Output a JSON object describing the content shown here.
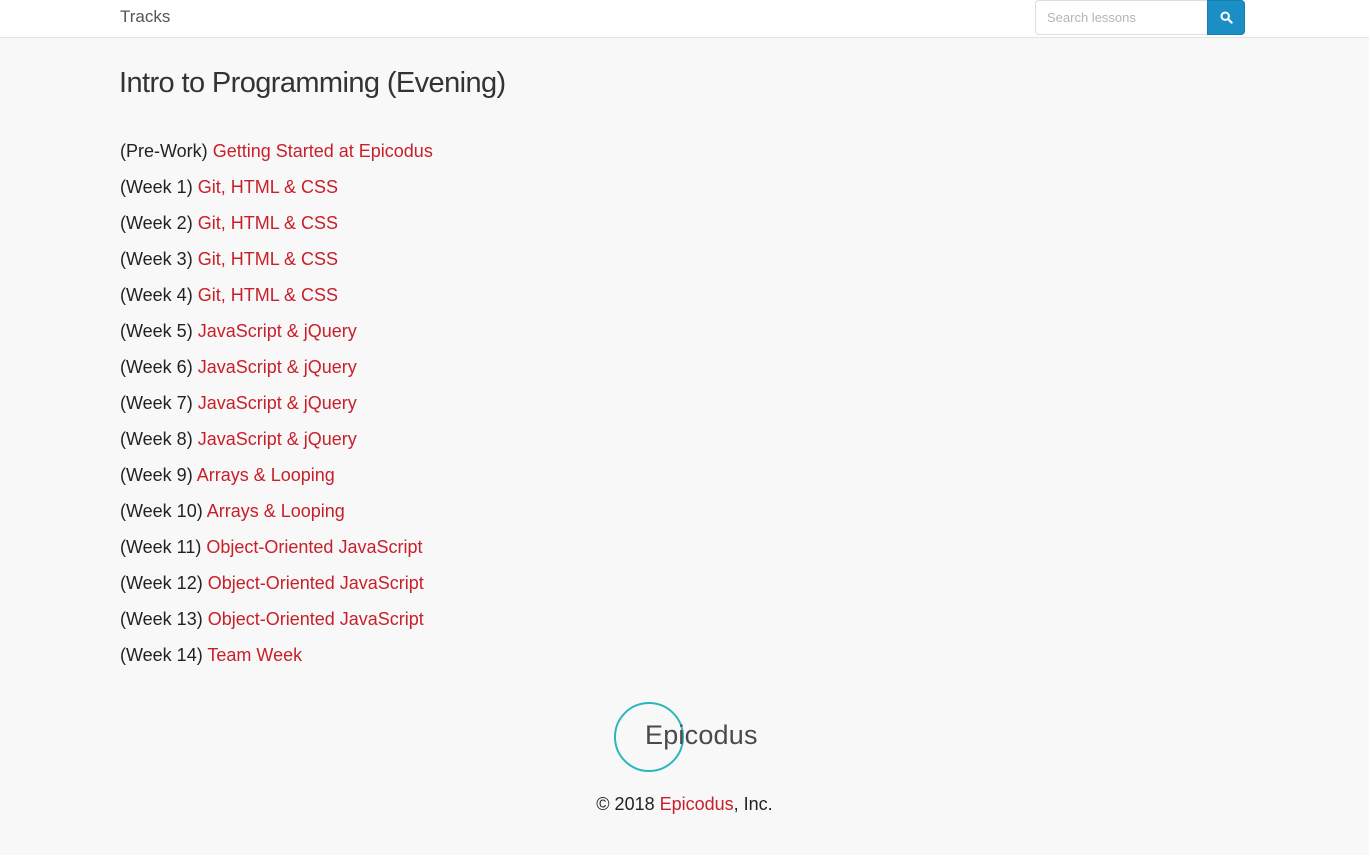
{
  "nav": {
    "brand": "Tracks",
    "search": {
      "placeholder": "Search lessons",
      "value": ""
    },
    "search_button_icon": "search-icon"
  },
  "page": {
    "title": "Intro to Programming (Evening)"
  },
  "lessons": [
    {
      "prefix": "(Pre-Work)",
      "title": "Getting Started at Epicodus"
    },
    {
      "prefix": "(Week 1)",
      "title": "Git, HTML & CSS"
    },
    {
      "prefix": "(Week 2)",
      "title": "Git, HTML & CSS"
    },
    {
      "prefix": "(Week 3)",
      "title": "Git, HTML & CSS"
    },
    {
      "prefix": "(Week 4)",
      "title": "Git, HTML & CSS"
    },
    {
      "prefix": "(Week 5)",
      "title": "JavaScript & jQuery"
    },
    {
      "prefix": "(Week 6)",
      "title": "JavaScript & jQuery"
    },
    {
      "prefix": "(Week 7)",
      "title": "JavaScript & jQuery"
    },
    {
      "prefix": "(Week 8)",
      "title": "JavaScript & jQuery"
    },
    {
      "prefix": "(Week 9)",
      "title": "Arrays & Looping"
    },
    {
      "prefix": "(Week 10)",
      "title": "Arrays & Looping"
    },
    {
      "prefix": "(Week 11)",
      "title": "Object-Oriented JavaScript"
    },
    {
      "prefix": "(Week 12)",
      "title": "Object-Oriented JavaScript"
    },
    {
      "prefix": "(Week 13)",
      "title": "Object-Oriented JavaScript"
    },
    {
      "prefix": "(Week 14)",
      "title": "Team Week"
    }
  ],
  "footer": {
    "logo_text": "Epicodus",
    "copyright_prefix": "© 2018 ",
    "copyright_link": "Epicodus",
    "copyright_suffix": ", Inc."
  },
  "colors": {
    "link": "#c8202a",
    "search_button": "#1b8ec5",
    "logo_circle": "#2bb6bd",
    "background": "#f8f8f8"
  }
}
